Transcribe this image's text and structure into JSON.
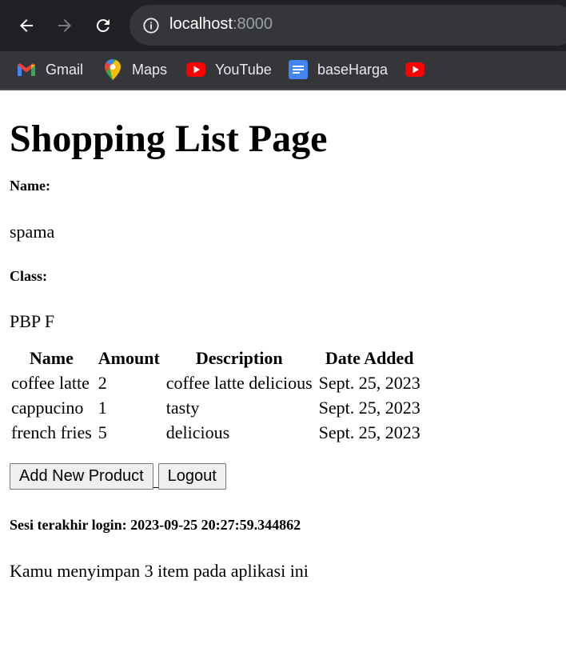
{
  "browser": {
    "url_host": "localhost",
    "url_port": ":8000",
    "bookmarks": [
      {
        "label": "Gmail",
        "icon": "gmail-icon"
      },
      {
        "label": "Maps",
        "icon": "maps-icon"
      },
      {
        "label": "YouTube",
        "icon": "youtube-icon"
      },
      {
        "label": "baseHarga",
        "icon": "docs-icon"
      },
      {
        "label": "",
        "icon": "youtube-icon"
      }
    ]
  },
  "page": {
    "title": "Shopping List Page",
    "name_label": "Name:",
    "name_value": "spama",
    "class_label": "Class:",
    "class_value": "PBP F",
    "table": {
      "headers": [
        "Name",
        "Amount",
        "Description",
        "Date Added"
      ],
      "rows": [
        [
          "coffee latte",
          "2",
          "coffee latte delicious",
          "Sept. 25, 2023"
        ],
        [
          "cappucino",
          "1",
          "tasty",
          "Sept. 25, 2023"
        ],
        [
          "french fries",
          "5",
          "delicious",
          "Sept. 25, 2023"
        ]
      ]
    },
    "add_button": "Add New Product",
    "logout_button": "Logout",
    "last_login": "Sesi terakhir login: 2023-09-25 20:27:59.344862",
    "summary": "Kamu menyimpan 3 item pada aplikasi ini"
  }
}
